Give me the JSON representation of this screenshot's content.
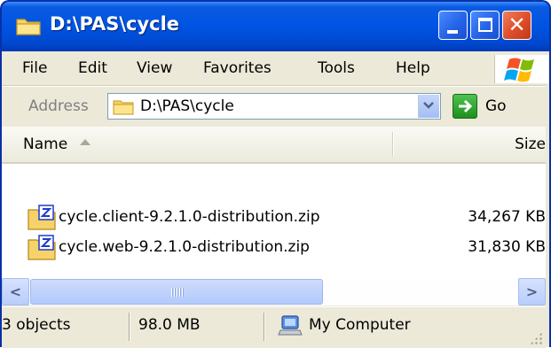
{
  "window": {
    "title": "D:\\PAS\\cycle",
    "buttons": [
      "minimize",
      "maximize",
      "close"
    ]
  },
  "menubar": {
    "items": [
      "File",
      "Edit",
      "View",
      "Favorites",
      "Tools",
      "Help"
    ]
  },
  "address": {
    "label": "Address",
    "value": "D:\\PAS\\cycle",
    "go_label": "Go"
  },
  "columns": {
    "name": "Name",
    "size": "Size"
  },
  "files": [
    {
      "name": "cycle.client-9.2.1.0-distribution.zip",
      "size": "34,267 KB",
      "icon": "zip-folder-icon"
    },
    {
      "name": "cycle.web-9.2.1.0-distribution.zip",
      "size": "31,830 KB",
      "icon": "zip-folder-icon"
    }
  ],
  "statusbar": {
    "objects": "3 objects",
    "size": "98.0 MB",
    "location": "My Computer"
  },
  "colors": {
    "title_blue": "#0054e3",
    "chrome": "#ece9d8",
    "close_red": "#e0502a"
  }
}
